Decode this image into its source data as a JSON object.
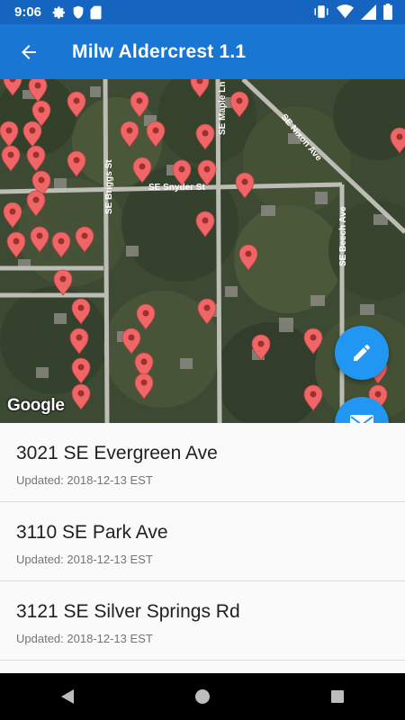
{
  "status": {
    "time": "9:06",
    "icons": [
      "settings-icon",
      "shield-icon",
      "sd-card-icon",
      "vibrate-icon",
      "wifi-icon",
      "signal-icon",
      "battery-icon"
    ]
  },
  "appbar": {
    "title": "Milw Aldercrest 1.1",
    "back_icon": "arrow-back-icon"
  },
  "map": {
    "streets": [
      "SE Briggs St",
      "SE Snyder St",
      "SE Maple Ln",
      "SE Nixon Ave",
      "SE Beech Ave"
    ],
    "attribution": "Google",
    "pin_color": "#f06666"
  },
  "fabs": {
    "edit_icon": "pencil-icon",
    "mail_icon": "mail-icon",
    "color": "#2196f3"
  },
  "list": [
    {
      "address": "3021 SE Evergreen Ave",
      "updated": "Updated: 2018-12-13 EST"
    },
    {
      "address": "3110 SE Park Ave",
      "updated": "Updated: 2018-12-13 EST"
    },
    {
      "address": "3121 SE Silver Springs Rd",
      "updated": "Updated: 2018-12-13 EST"
    }
  ],
  "navbar": {
    "icons": [
      "back-triangle-icon",
      "home-circle-icon",
      "recents-square-icon"
    ]
  },
  "colors": {
    "statusbar": "#1565c0",
    "appbar": "#1976d2",
    "accent": "#2196f3"
  }
}
